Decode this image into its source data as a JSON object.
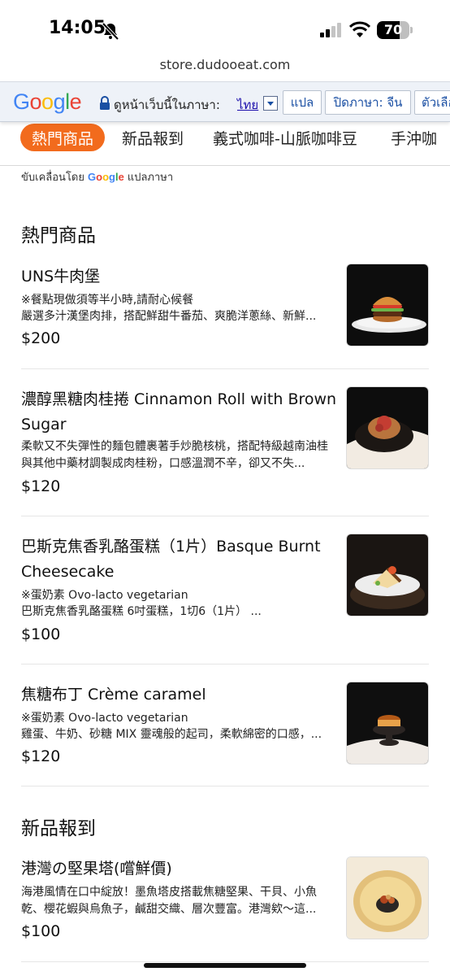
{
  "status": {
    "time": "14:05",
    "battery": "70",
    "battery_level": 0.7
  },
  "browser": {
    "url": "store.dudooeat.com"
  },
  "translate_bar": {
    "logo": "Google",
    "prompt": "ดูหน้าเว็บนี้ในภาษา:",
    "language": "ไทย",
    "translate_button": "แปล",
    "disable_button": "ปิดภาษา: จีน",
    "options_button": "ตัวเลือ"
  },
  "tabs": [
    "熱門商品",
    "新品報到",
    "義式咖啡-山脈咖啡豆",
    "手沖咖"
  ],
  "powered_by": {
    "prefix": "ขับเคลื่อนโดย",
    "brand": "Google",
    "suffix": "แปลภาษา"
  },
  "sections": [
    {
      "title": "熱門商品",
      "items": [
        {
          "name": "UNS牛肉堡",
          "note": "※餐點現做須等半小時,請耐心候餐",
          "desc": "嚴選多汁漢堡肉排，搭配鮮甜牛番茄、爽脆洋蔥絲、新鮮...",
          "price": "$200",
          "image": "burger"
        },
        {
          "name": "濃醇黑糖肉桂捲 Cinnamon Roll with Brown Sugar",
          "note": "",
          "desc": "柔軟又不失彈性的麵包體裹著手炒脆核桃，搭配特級越南油桂與其他中藥材調製成肉桂粉，口感溫潤不辛，卻又不失...",
          "price": "$120",
          "image": "cinnamon-roll"
        },
        {
          "name": "巴斯克焦香乳酪蛋糕（1片）Basque Burnt Cheesecake",
          "note": "※蛋奶素 Ovo-lacto vegetarian",
          "desc": "巴斯克焦香乳酪蛋糕 6吋蛋糕，1切6（1片） ...",
          "price": "$100",
          "image": "cheesecake"
        },
        {
          "name": "焦糖布丁 Crème caramel",
          "note": "※蛋奶素 Ovo-lacto vegetarian",
          "desc": "雞蛋、牛奶、砂糖 MIX 靈魂般的起司，柔軟綿密的口感，...",
          "price": "$120",
          "image": "pudding"
        }
      ]
    },
    {
      "title": "新品報到",
      "items": [
        {
          "name": "港灣の堅果塔(嚐鮮價)",
          "note": "",
          "desc": "海港風情在口中綻放！墨魚塔皮搭載焦糖堅果、干貝、小魚乾、櫻花蝦與烏魚子，鹹甜交織、層次豐富。港灣欸～這...",
          "price": "$100",
          "image": "nut-tart"
        }
      ]
    }
  ],
  "colors": {
    "accent": "#f26b1d",
    "link": "#1a0dab"
  }
}
